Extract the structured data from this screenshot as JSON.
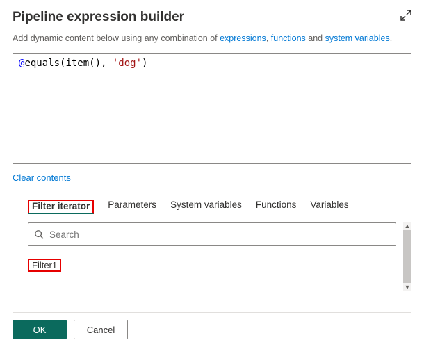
{
  "header": {
    "title": "Pipeline expression builder"
  },
  "hint": {
    "prefix": "Add dynamic content below using any combination of ",
    "link_expressions": "expressions",
    "sep1": ", ",
    "link_functions": "functions",
    "sep2": " and ",
    "link_sysvars": "system variables",
    "suffix": "."
  },
  "editor": {
    "at": "@",
    "fn_open": "equals(item(), ",
    "str": "'dog'",
    "fn_close": ")"
  },
  "clear_label": "Clear contents",
  "tabs": {
    "filter_iterator": "Filter iterator",
    "parameters": "Parameters",
    "system_variables": "System variables",
    "functions": "Functions",
    "variables": "Variables"
  },
  "search": {
    "placeholder": "Search"
  },
  "results": {
    "item1": "Filter1"
  },
  "buttons": {
    "ok": "OK",
    "cancel": "Cancel"
  }
}
